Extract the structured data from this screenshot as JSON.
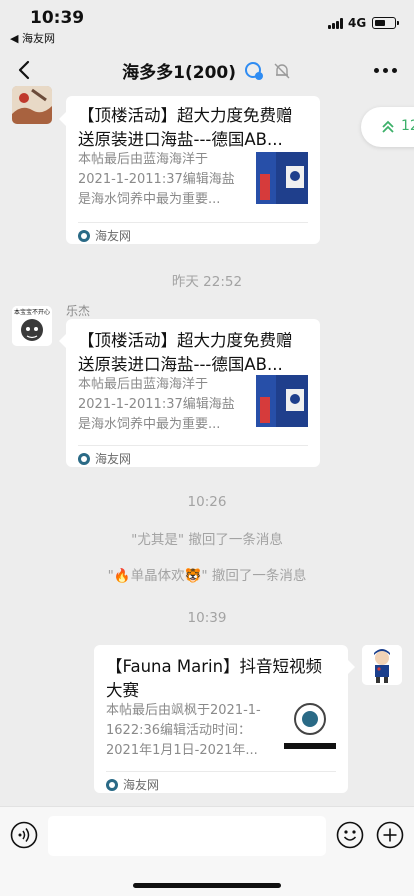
{
  "status_bar": {
    "time": "10:39",
    "back_app": "◀ 海友网",
    "network": "4G"
  },
  "nav": {
    "title": "海多多1(200)",
    "colors": {
      "group_icon": "#2f8cf2"
    }
  },
  "unread_pill": {
    "count": "12",
    "color": "#3db06a"
  },
  "messages": [
    {
      "title": "【顶楼活动】超大力度免费赠送原装进口海盐---德国AB...",
      "desc": "本帖最后由蓝海海洋于2021-1-2011:37编辑海盐是海水饲养中最为重要...",
      "source": "海友网"
    },
    {
      "time": "昨天 22:52",
      "sender": "乐杰",
      "avatar_text": "本宝宝不开心",
      "title": "【顶楼活动】超大力度免费赠送原装进口海盐---德国AB...",
      "desc": "本帖最后由蓝海海洋于2021-1-2011:37编辑海盐是海水饲养中最为重要...",
      "source": "海友网"
    },
    {
      "time": "10:26",
      "recall_1": "\"尤其是\" 撤回了一条消息",
      "recall_2": "\"🔥单晶体欢🐯\" 撤回了一条消息"
    },
    {
      "time": "10:39",
      "title": "【Fauna Marin】抖音短视频大赛",
      "desc": "本帖最后由飒枫于2021-1-1622:36编辑活动时间：2021年1月1日-2021年...",
      "source": "海友网"
    }
  ],
  "input": {
    "placeholder": ""
  }
}
